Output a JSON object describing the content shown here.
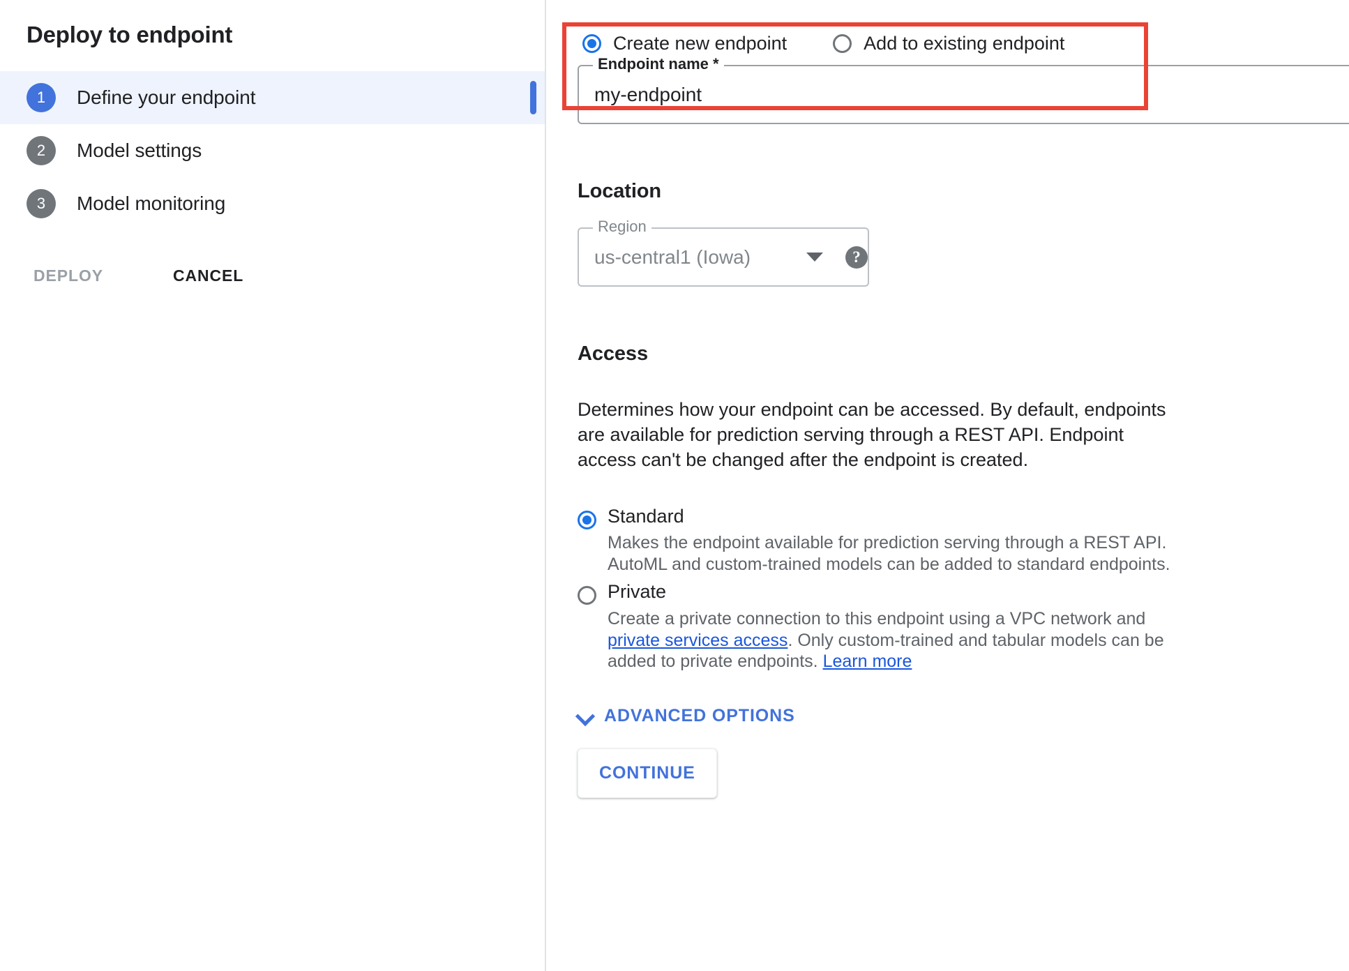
{
  "wizard": {
    "title": "Deploy to endpoint",
    "steps": [
      {
        "num": "1",
        "label": "Define your endpoint"
      },
      {
        "num": "2",
        "label": "Model settings"
      },
      {
        "num": "3",
        "label": "Model monitoring"
      }
    ],
    "deploy_label": "DEPLOY",
    "cancel_label": "CANCEL"
  },
  "endpoint_mode": {
    "options": [
      {
        "label": "Create new endpoint",
        "selected": true
      },
      {
        "label": "Add to existing endpoint",
        "selected": false
      }
    ]
  },
  "endpoint_name": {
    "legend": "Endpoint name *",
    "value": "my-endpoint",
    "help_glyph": "?"
  },
  "location": {
    "heading": "Location",
    "region": {
      "legend": "Region",
      "value": "us-central1 (Iowa)",
      "help_glyph": "?"
    }
  },
  "access": {
    "heading": "Access",
    "description": "Determines how your endpoint can be accessed. By default, endpoints are available for prediction serving through a REST API. Endpoint access can't be changed after the endpoint is created.",
    "options": [
      {
        "title": "Standard",
        "selected": true,
        "desc_pre": "Makes the endpoint available for prediction serving through a REST API. AutoML and custom-trained models can be added to standard endpoints.",
        "link1": "",
        "desc_mid": "",
        "link2": "",
        "desc_post": ""
      },
      {
        "title": "Private",
        "selected": false,
        "desc_pre": "Create a private connection to this endpoint using a VPC network and ",
        "link1": "private services access",
        "desc_mid": ". Only custom-trained and tabular models can be added to private endpoints. ",
        "link2": "Learn more",
        "desc_post": ""
      }
    ]
  },
  "advanced_options_label": "ADVANCED OPTIONS",
  "continue_label": "CONTINUE",
  "colors": {
    "accent": "#4272db",
    "radio_accent": "#1a73e8",
    "link": "#1a56db",
    "highlight_border": "#ea4335",
    "active_row_bg": "#eef3fd",
    "muted_text": "#5f6368",
    "disabled_text": "#80868b"
  }
}
